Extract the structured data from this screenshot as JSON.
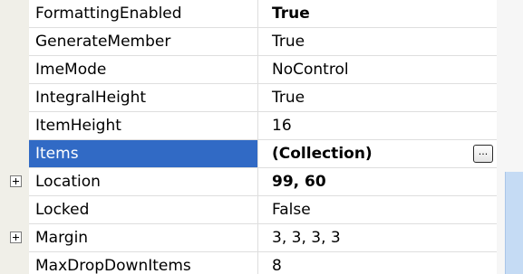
{
  "properties": [
    {
      "name": "FormattingEnabled",
      "value": "True",
      "bold": true,
      "expandable": false,
      "selected": false
    },
    {
      "name": "GenerateMember",
      "value": "True",
      "bold": false,
      "expandable": false,
      "selected": false
    },
    {
      "name": "ImeMode",
      "value": "NoControl",
      "bold": false,
      "expandable": false,
      "selected": false
    },
    {
      "name": "IntegralHeight",
      "value": "True",
      "bold": false,
      "expandable": false,
      "selected": false
    },
    {
      "name": "ItemHeight",
      "value": "16",
      "bold": false,
      "expandable": false,
      "selected": false
    },
    {
      "name": "Items",
      "value": "(Collection)",
      "bold": true,
      "expandable": false,
      "selected": true
    },
    {
      "name": "Location",
      "value": "99, 60",
      "bold": true,
      "expandable": true,
      "selected": false
    },
    {
      "name": "Locked",
      "value": "False",
      "bold": false,
      "expandable": false,
      "selected": false
    },
    {
      "name": "Margin",
      "value": "3, 3, 3, 3",
      "bold": false,
      "expandable": true,
      "selected": false
    },
    {
      "name": "MaxDropDownItems",
      "value": "8",
      "bold": false,
      "expandable": false,
      "selected": false
    }
  ],
  "ellipsis_button_label": "...",
  "colors": {
    "selection": "#316ac5",
    "gutter": "#f0efe8",
    "grid_line": "#dedede",
    "scroll_thumb": "#c5dbf4"
  },
  "icons": {
    "expand": "plus-box-icon",
    "ellipsis": "ellipsis-icon"
  }
}
